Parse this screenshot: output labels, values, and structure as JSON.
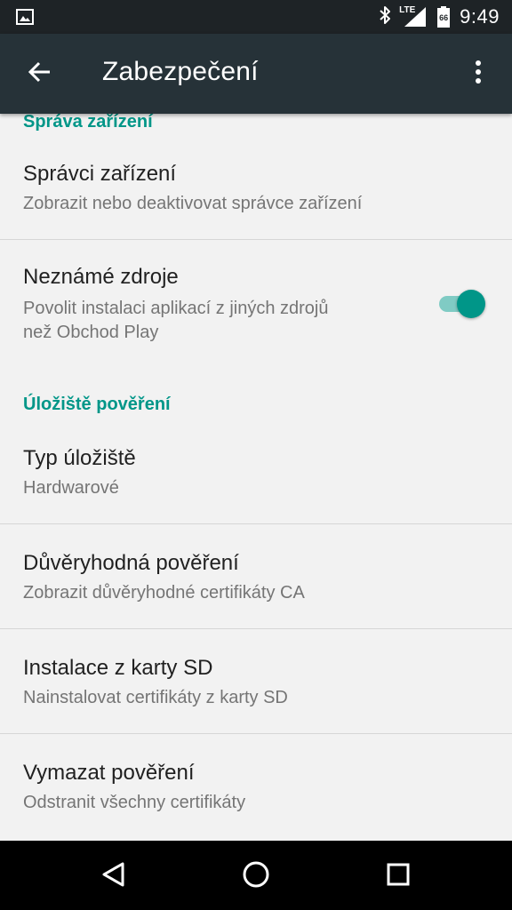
{
  "status_bar": {
    "time": "9:49",
    "network": "LTE",
    "battery_level": "66",
    "icons": [
      "image-icon",
      "bluetooth-icon",
      "signal-icon",
      "battery-icon"
    ]
  },
  "app_bar": {
    "title": "Zabezpečení",
    "back_icon": "arrow-left-icon",
    "menu_icon": "more-vert-icon"
  },
  "sections": [
    {
      "header": "Správa zařízení",
      "items": [
        {
          "title": "Správci zařízení",
          "summary": "Zobrazit nebo deaktivovat správce zařízení"
        },
        {
          "title": "Neznámé zdroje",
          "summary": "Povolit instalaci aplikací z jiných zdrojů\nnež Obchod Play",
          "toggle": true
        }
      ]
    },
    {
      "header": "Úložiště pověření",
      "items": [
        {
          "title": "Typ úložiště",
          "summary": "Hardwarové"
        },
        {
          "title": "Důvěryhodná pověření",
          "summary": "Zobrazit důvěryhodné certifikáty CA"
        },
        {
          "title": "Instalace z karty SD",
          "summary": "Nainstalovat certifikáty z karty SD"
        },
        {
          "title": "Vymazat pověření",
          "summary": "Odstranit všechny certifikáty"
        }
      ]
    }
  ],
  "nav_bar": {
    "buttons": [
      "back-triangle-icon",
      "home-circle-icon",
      "recents-square-icon"
    ]
  },
  "colors": {
    "accent": "#009688",
    "app_bar": "#263238",
    "status_bar": "#1e2326",
    "background": "#f2f2f2"
  }
}
